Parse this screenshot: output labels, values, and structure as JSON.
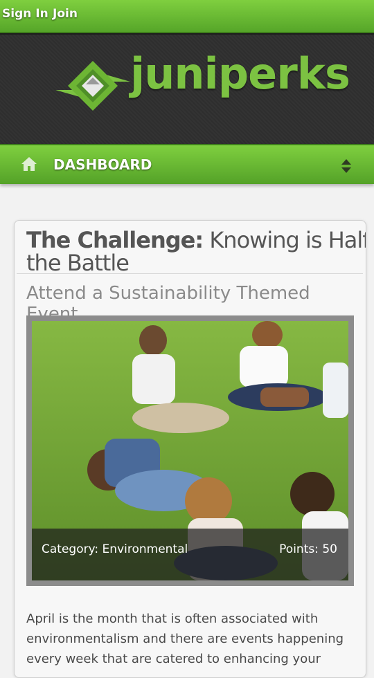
{
  "auth": {
    "sign_in": "Sign In",
    "join": "Join"
  },
  "brand": {
    "name": "juniperks",
    "color": "#7cc242"
  },
  "nav": {
    "label": "DASHBOARD",
    "home_icon": "home-icon",
    "toggle_icon": "up-down-arrows-icon"
  },
  "challenge": {
    "title_prefix": "The Challenge:",
    "title_rest": " Knowing is Half the Battle",
    "subtitle": "Attend a Sustainability Themed Event",
    "category": "Category: Environmental",
    "points": "Points: 50",
    "description": "April is the month that is often associated with environmentalism and there are events happening every week that are catered to enhancing your"
  },
  "colors": {
    "green_light": "#7fcf3f",
    "green_dark": "#54a228",
    "header_dark": "#2e2e2e"
  }
}
